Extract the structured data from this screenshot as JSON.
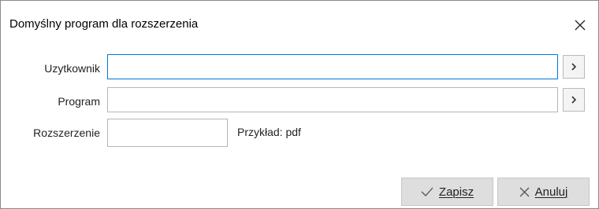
{
  "dialog": {
    "title": "Domyślny program dla rozszerzenia",
    "close_icon": "close-icon"
  },
  "form": {
    "user": {
      "label": "Uzytkownik",
      "value": "",
      "button_icon": "chevron-right-icon"
    },
    "program": {
      "label": "Program",
      "value": "",
      "button_icon": "chevron-right-icon"
    },
    "extension": {
      "label": "Rozszerzenie",
      "value": "",
      "hint": "Przykład: pdf"
    }
  },
  "buttons": {
    "save_label": "Zapisz",
    "save_icon": "checkmark-icon",
    "cancel_label": "Anuluj",
    "cancel_icon": "x-icon"
  }
}
